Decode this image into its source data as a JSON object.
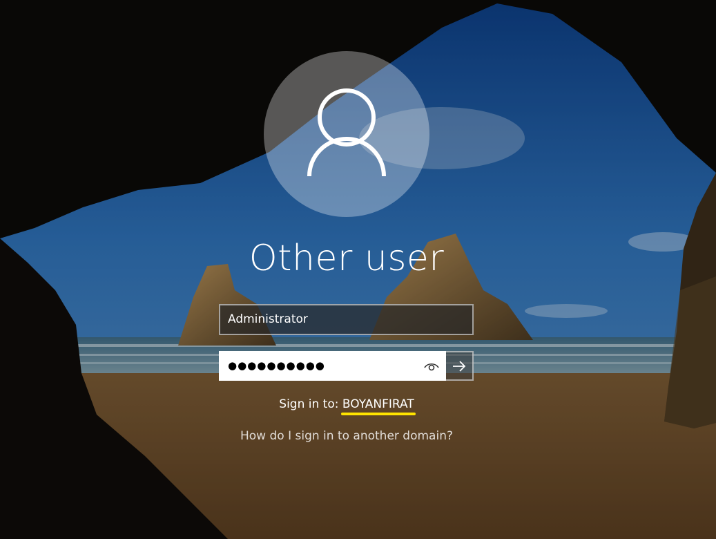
{
  "login": {
    "display_name": "Other user",
    "username_value": "Administrator",
    "password_masked": "●●●●●●●●●●",
    "signin_prefix": "Sign in to: ",
    "domain": "BOYANFIRAT",
    "other_domain_link": "How do I sign in to another domain?"
  },
  "icons": {
    "avatar": "user-silhouette-icon",
    "reveal": "eye-icon",
    "submit": "arrow-right-icon"
  },
  "colors": {
    "domain_highlight": "#ffe400",
    "field_background": "#ffffff"
  }
}
